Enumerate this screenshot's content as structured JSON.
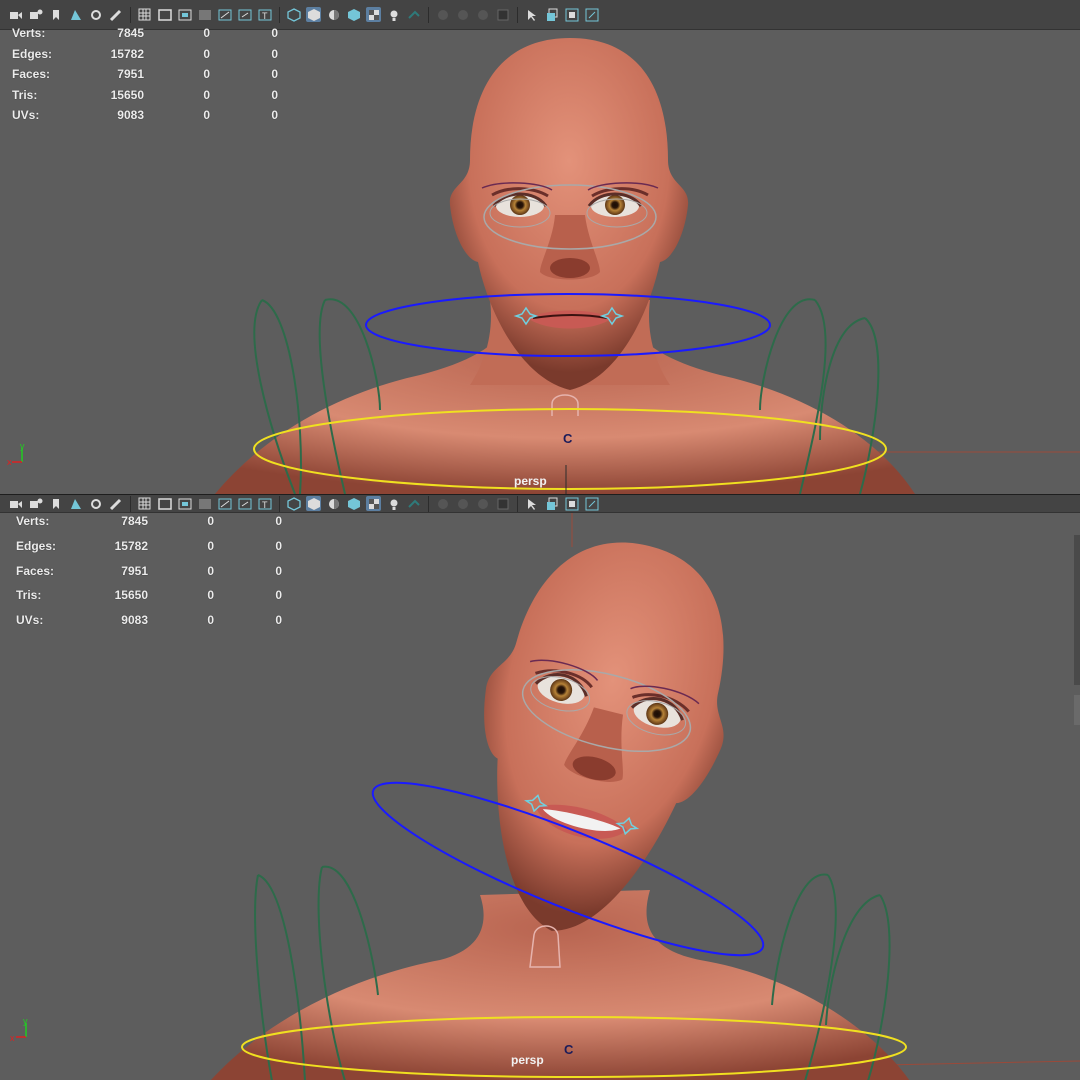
{
  "viewports": [
    {
      "camera": "persp",
      "control_label": "C",
      "stats": [
        {
          "label": "Verts:",
          "value": "7845",
          "c2": "0",
          "c3": "0"
        },
        {
          "label": "Edges:",
          "value": "15782",
          "c2": "0",
          "c3": "0"
        },
        {
          "label": "Faces:",
          "value": "7951",
          "c2": "0",
          "c3": "0"
        },
        {
          "label": "Tris:",
          "value": "15650",
          "c2": "0",
          "c3": "0"
        },
        {
          "label": "UVs:",
          "value": "9083",
          "c2": "0",
          "c3": "0"
        }
      ]
    },
    {
      "camera": "persp",
      "control_label": "C",
      "stats": [
        {
          "label": "Verts:",
          "value": "7845",
          "c2": "0",
          "c3": "0"
        },
        {
          "label": "Edges:",
          "value": "15782",
          "c2": "0",
          "c3": "0"
        },
        {
          "label": "Faces:",
          "value": "7951",
          "c2": "0",
          "c3": "0"
        },
        {
          "label": "Tris:",
          "value": "15650",
          "c2": "0",
          "c3": "0"
        },
        {
          "label": "UVs:",
          "value": "9083",
          "c2": "0",
          "c3": "0"
        }
      ]
    }
  ],
  "axis": {
    "y": "y",
    "x": "x"
  },
  "toolbar_icons": [
    "camera-icon",
    "camera-attributes-icon",
    "bookmark-icon",
    "image-plane-icon",
    "2d-pan-zoom-icon",
    "grease-pencil-icon",
    "grid-icon",
    "film-gate-icon",
    "resolution-gate-icon",
    "gate-mask-icon",
    "field-chart-icon",
    "safe-action-icon",
    "safe-title-icon",
    "wireframe-icon",
    "smooth-shade-icon",
    "default-material-icon",
    "shade-wireframe-icon",
    "textured-icon",
    "lights-icon",
    "shadows-icon",
    "ambient-occlusion-icon",
    "motion-blur-icon",
    "anti-aliasing-icon",
    "depth-of-field-icon",
    "isolate-select-icon",
    "xray-icon",
    "xray-active-components-icon",
    "xray-joints-icon"
  ],
  "colors": {
    "viewport_bg": "#5d5d5d",
    "skin": "#d27a62",
    "ctrl_blue": "#1a1aff",
    "ctrl_yellow": "#f0e020",
    "ctrl_green": "#2d6b4a",
    "ctrl_gray": "#a9a9a9",
    "ctrl_pink": "#e6b3ad",
    "ctrl_cyan": "#6fd0e0",
    "toolbar_active": "#5c7fa1"
  }
}
